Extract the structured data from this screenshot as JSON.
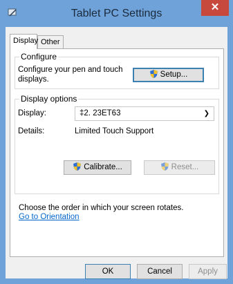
{
  "window": {
    "title": "Tablet PC Settings",
    "close_symbol": "✕",
    "icon": "tablet-settings-icon"
  },
  "tabs": [
    {
      "label": "Display",
      "active": true
    },
    {
      "label": "Other",
      "active": false
    }
  ],
  "configure": {
    "group_title": "Configure",
    "description": "Configure your pen and touch displays.",
    "setup_button": "Setup..."
  },
  "display_options": {
    "group_title": "Display options",
    "display_label": "Display:",
    "display_value": "2. 23ET63",
    "display_prefix": "‡",
    "details_label": "Details:",
    "details_value": "Limited Touch Support",
    "calibrate_button": "Calibrate...",
    "reset_button": "Reset..."
  },
  "orientation": {
    "text": "Choose the order in which your screen rotates.",
    "link": "Go to Orientation"
  },
  "footer": {
    "ok": "OK",
    "cancel": "Cancel",
    "apply": "Apply"
  },
  "colors": {
    "frame": "#6ea2d8",
    "close": "#c7493e",
    "link": "#0066cc"
  }
}
